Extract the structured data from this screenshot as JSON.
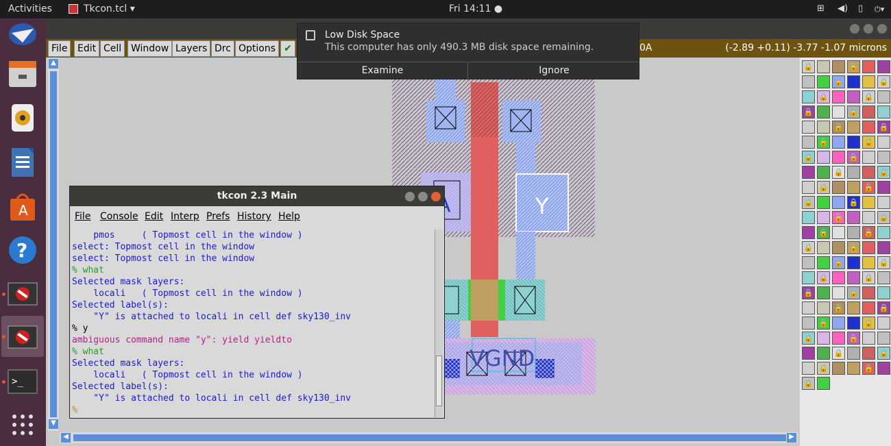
{
  "topbar": {
    "activities": "Activities",
    "app": "Tkcon.tcl ▾",
    "clock": "Fri 14:11 ●"
  },
  "magic": {
    "menus": [
      "File",
      "Edit",
      "Cell",
      "Window",
      "Layers",
      "Drc",
      "Options"
    ],
    "cursor_suffix": "0A",
    "coords": "(-2.89 +0.11) -3.77 -1.07 microns"
  },
  "notification": {
    "title": "Low Disk Space",
    "body": "This computer has only 490.3 MB disk space remaining.",
    "examine": "Examine",
    "ignore": "Ignore"
  },
  "layout": {
    "label_a": "A",
    "label_y": "Y",
    "label_vgnd": "VGND"
  },
  "tkcon": {
    "title": "tkcon 2.3 Main",
    "menus": [
      "File",
      "Console",
      "Edit",
      "Interp",
      "Prefs",
      "History",
      "Help"
    ],
    "lines": [
      {
        "text": "    pmos     ( Topmost cell in the window )",
        "color": "#1a1ad0"
      },
      {
        "text": "select: Topmost cell in the window",
        "color": "#1a1ad0"
      },
      {
        "text": "select: Topmost cell in the window",
        "color": "#1a1ad0"
      },
      {
        "text": "% what",
        "color": "#20a020"
      },
      {
        "text": "Selected mask layers:",
        "color": "#1a1ad0"
      },
      {
        "text": "    locali   ( Topmost cell in the window )",
        "color": "#1a1ad0"
      },
      {
        "text": "Selected label(s):",
        "color": "#1a1ad0"
      },
      {
        "text": "    \"Y\" is attached to locali in cell def sky130_inv",
        "color": "#1a1ad0"
      },
      {
        "text": "% y",
        "color": "#000000"
      },
      {
        "text": "ambiguous command name \"y\": yield yieldto",
        "color": "#c01a8a"
      },
      {
        "text": "% what",
        "color": "#20a020"
      },
      {
        "text": "Selected mask layers:",
        "color": "#1a1ad0"
      },
      {
        "text": "    locali   ( Topmost cell in the window )",
        "color": "#1a1ad0"
      },
      {
        "text": "Selected label(s):",
        "color": "#1a1ad0"
      },
      {
        "text": "    \"Y\" is attached to locali in cell def sky130_inv",
        "color": "#1a1ad0"
      },
      {
        "text": "%",
        "color": "#b5882a"
      }
    ]
  }
}
